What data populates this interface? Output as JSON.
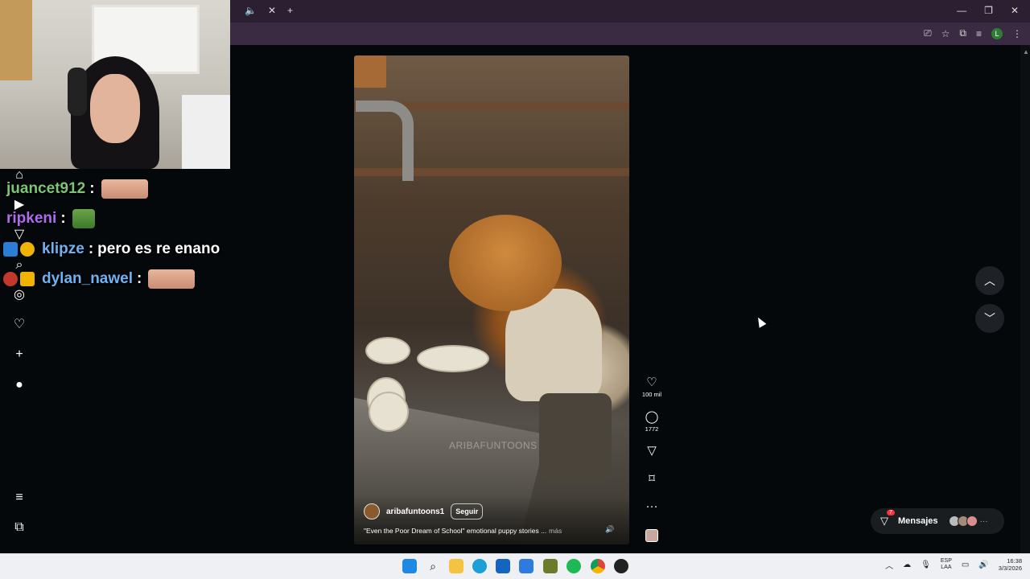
{
  "browser": {
    "tab_mute_icon": "speaker-icon",
    "tab_close_glyph": "✕",
    "new_tab_glyph": "+",
    "window_controls": [
      "—",
      "❐",
      "✕"
    ],
    "toolbar_icons": [
      "cast-icon",
      "star-icon",
      "extensions-icon",
      "media-icon",
      "profile-icon",
      "menu-icon"
    ],
    "profile_initial": "L"
  },
  "chat": [
    {
      "user": "juancet912",
      "color": "#7cc576",
      "sep": ":",
      "message": "",
      "emote": "face"
    },
    {
      "user": "ripkeni",
      "color": "#b06cf0",
      "sep": ":",
      "message": "",
      "emote": "green"
    },
    {
      "user": "klipze",
      "color": "#6fb2f2",
      "sep": ":",
      "message": "pero es re enano",
      "emote": ""
    },
    {
      "user": "dylan_nawel",
      "color": "#6fb2f2",
      "sep": ":",
      "message": "",
      "emote": "face"
    }
  ],
  "sidebar": {
    "icons": [
      "home-icon",
      "reels-icon",
      "send-icon",
      "search-icon",
      "explore-icon",
      "heart-icon",
      "create-icon",
      "profile-icon",
      "menu-icon",
      "more-icon"
    ],
    "notif_count": "8"
  },
  "reel": {
    "watermark": "ARIBAFUNTOONS",
    "author": "aribafuntoons1",
    "follow_label": "Seguir",
    "caption": "\"Even the Poor Dream of School\" emotional puppy stories ...",
    "more_label": "más"
  },
  "actions": {
    "likes": "100 mil",
    "comments": "1772"
  },
  "messages": {
    "label": "Mensajes",
    "badge": "7"
  },
  "taskbar": {
    "lang_top": "ESP",
    "lang_bottom": "LAA",
    "time": "16:38",
    "date": "3/3/2026"
  }
}
